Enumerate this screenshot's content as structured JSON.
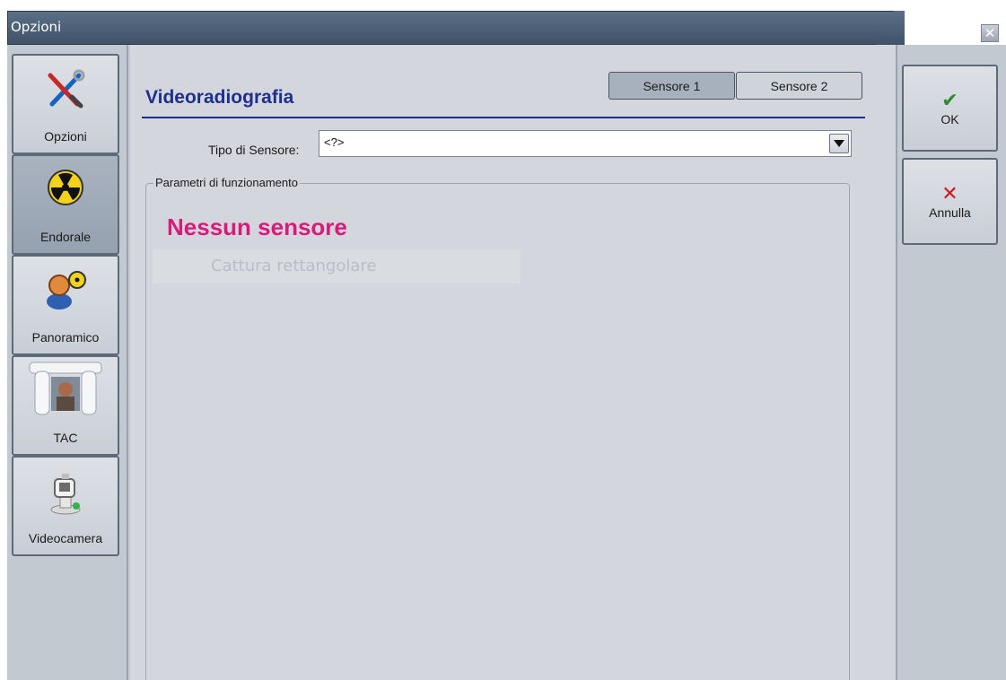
{
  "window": {
    "title": "Opzioni",
    "close_glyph": "✕"
  },
  "nav": {
    "items": [
      {
        "label": "Opzioni",
        "icon": "tools-icon"
      },
      {
        "label": "Endorale",
        "icon": "radiation-icon",
        "active": true
      },
      {
        "label": "Panoramico",
        "icon": "patient-radiation-icon"
      },
      {
        "label": "TAC",
        "icon": "ct-scanner-icon"
      },
      {
        "label": "Videocamera",
        "icon": "camera-icon"
      }
    ]
  },
  "header": {
    "title": "Videoradiografia"
  },
  "sensor_tabs": [
    {
      "label": "Sensore 1",
      "selected": true
    },
    {
      "label": "Sensore 2",
      "selected": false
    }
  ],
  "sensor_type": {
    "label": "Tipo di Sensore:",
    "value": "<?>"
  },
  "parameters": {
    "group_label": "Parametri di funzionamento",
    "status": "Nessun sensore",
    "capture_label": "Cattura rettangolare"
  },
  "actions": {
    "ok": {
      "label": "OK",
      "glyph": "✔",
      "color": "#2e8b2e"
    },
    "cancel": {
      "label": "Annulla",
      "glyph": "✕",
      "color": "#cc1a1a"
    }
  },
  "colors": {
    "title_blue": "#1f2f8f",
    "status_pink": "#d81b7a",
    "titlebar": "#4a5d74"
  }
}
